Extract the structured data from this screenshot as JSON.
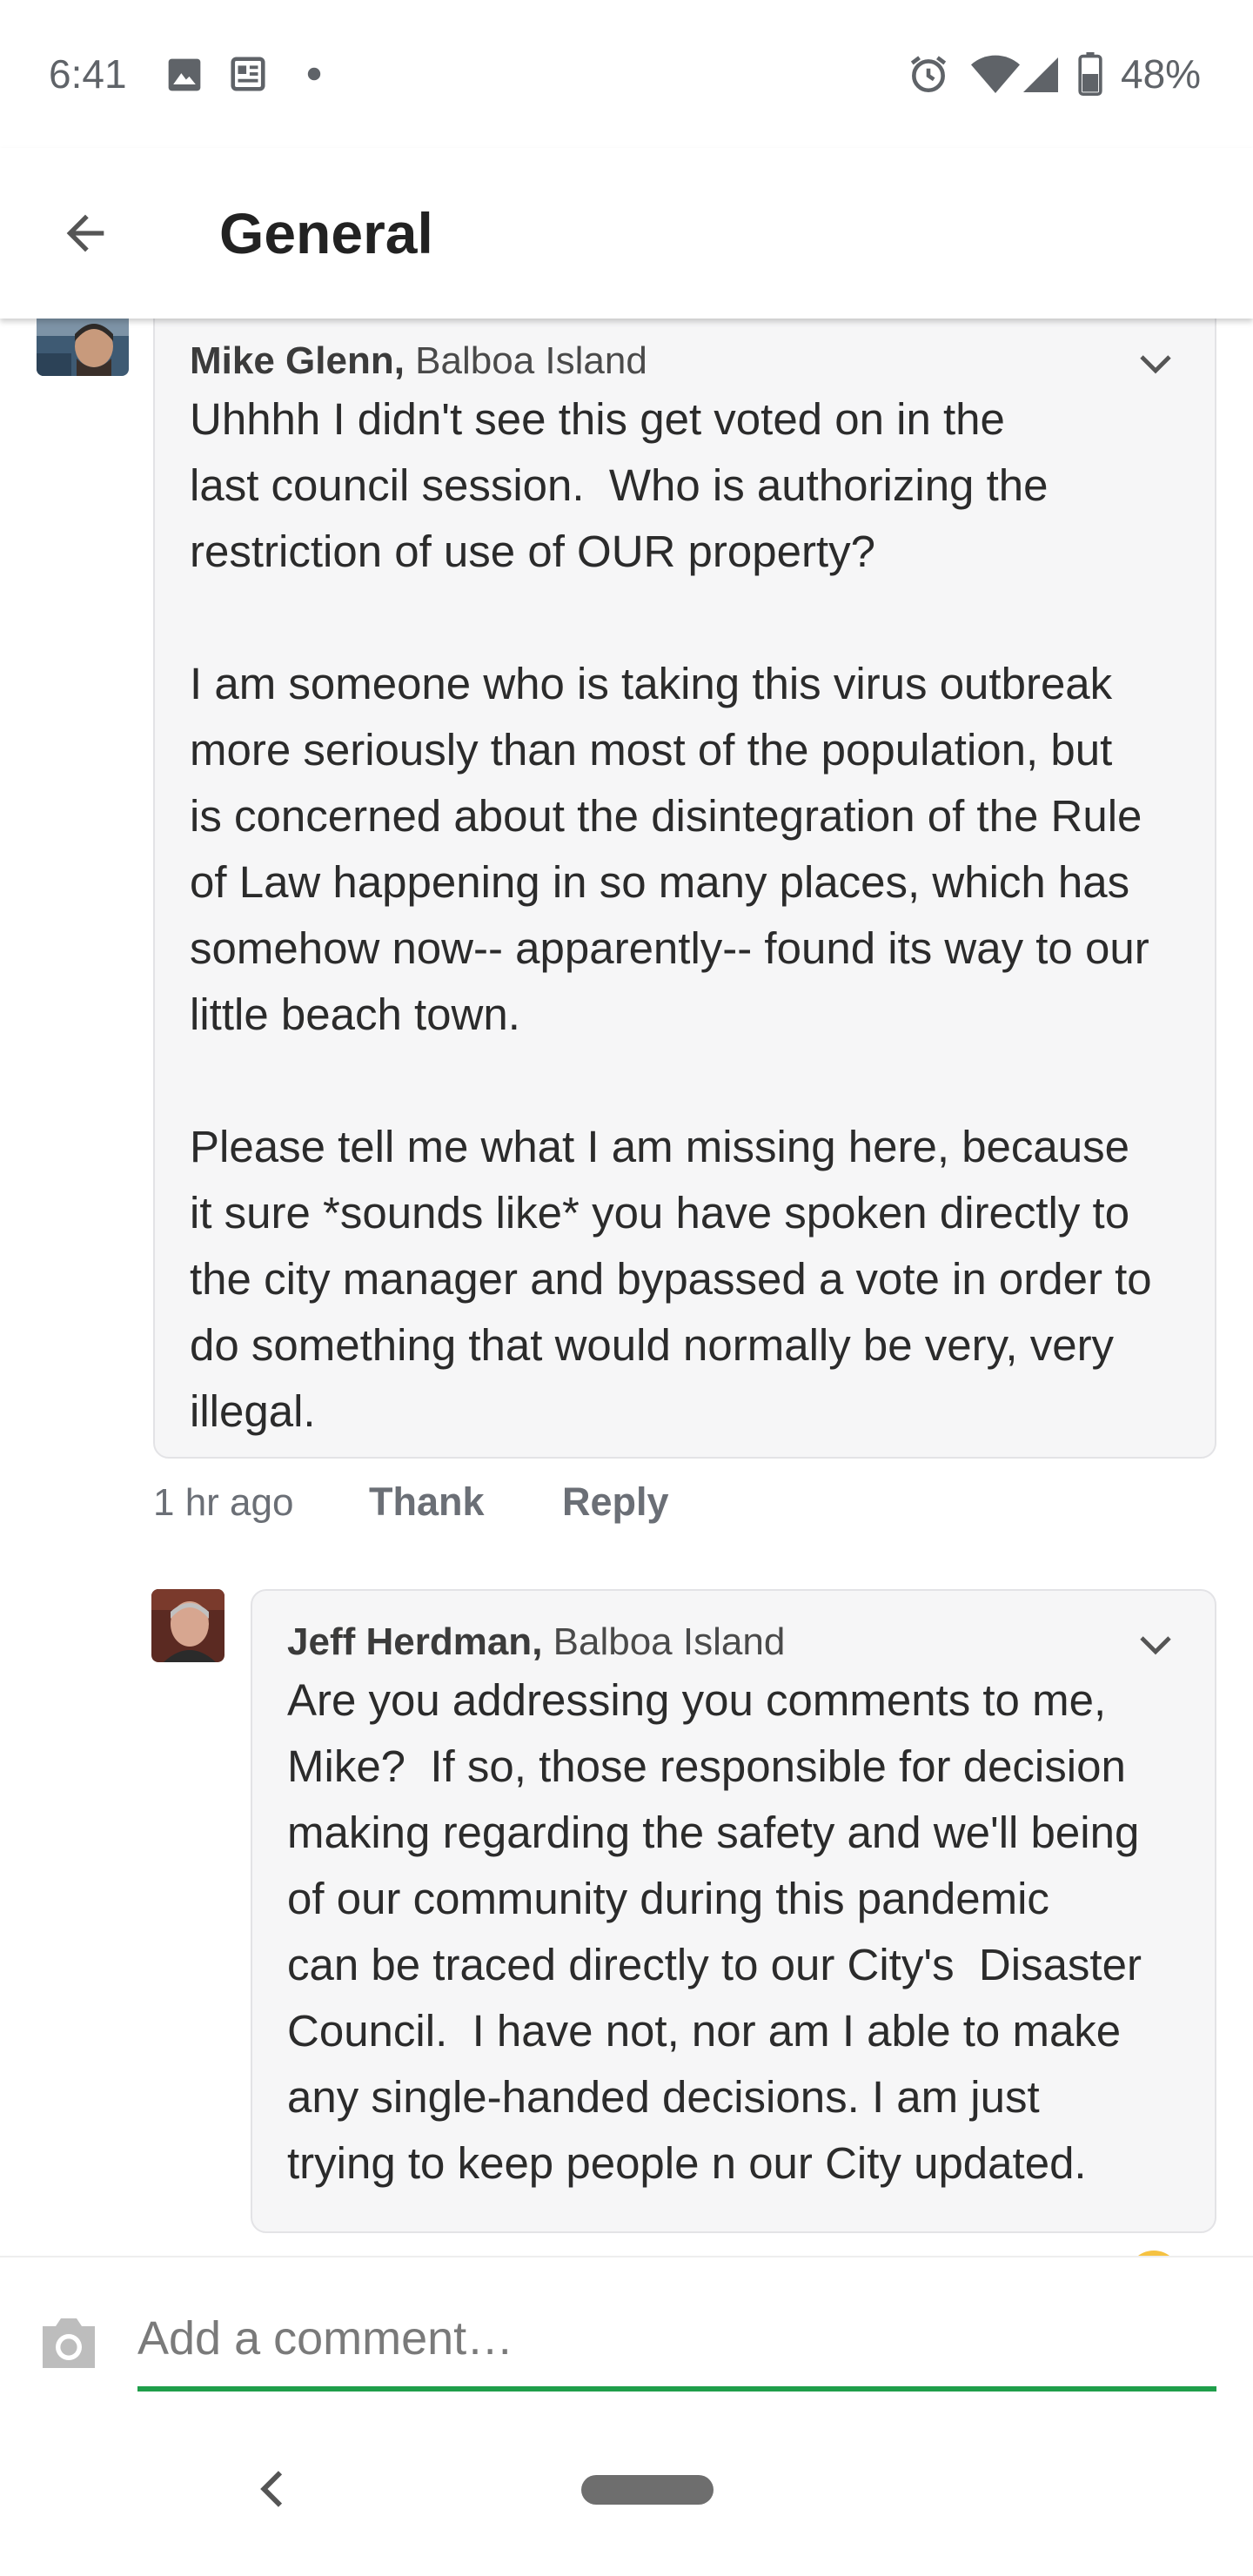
{
  "status_bar": {
    "time": "6:41",
    "battery": "48%",
    "left_icons": [
      "image-icon",
      "news-icon",
      "notification-dot-icon"
    ],
    "right_icons": [
      "alarm-icon",
      "wifi-icon",
      "cell-signal-icon",
      "battery-icon"
    ]
  },
  "app_bar": {
    "title": "General",
    "back_icon": "arrow-back-icon"
  },
  "comments": [
    {
      "author": "Mike Glenn,",
      "location": " Balboa Island",
      "body": "Uhhhh I didn't see this get voted on in the\nlast council session.  Who is authorizing the\nrestriction of use of OUR property?\n\nI am someone who is taking this virus outbreak\nmore seriously than most of the population, but\nis concerned about the disintegration of the Rule\nof Law happening in so many places, which has\nsomehow now-- apparently-- found its way to our\nlittle beach town.\n\nPlease tell me what I am missing here, because\nit sure *sounds like* you have spoken directly to\nthe city manager and bypassed a vote in order to\ndo something that would normally be very, very\nillegal.",
      "time": "1 hr ago",
      "thank_label": "Thank",
      "reply_label": "Reply"
    },
    {
      "author": "Jeff Herdman,",
      "location": " Balboa Island",
      "body": "Are you addressing you comments to me,\nMike?  If so, those responsible for decision\nmaking regarding the safety and we'll being\nof our community during this pandemic\ncan be traced directly to our City's  Disaster\nCouncil.  I have not, nor am I able to make\nany single-handed decisions. I am just\ntrying to keep people n our City updated."
    }
  ],
  "composer": {
    "placeholder": "Add a comment…"
  },
  "colors": {
    "accent_green": "#1f9e4a",
    "bubble_bg": "#f6f6f7",
    "muted_text": "#6b6f76"
  }
}
